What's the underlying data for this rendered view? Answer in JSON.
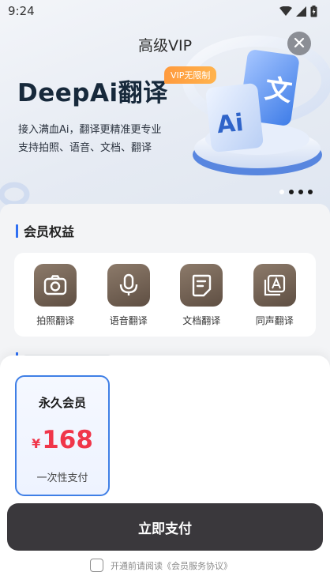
{
  "status_bar": {
    "time": "9:24"
  },
  "header": {
    "title": "高级VIP"
  },
  "hero": {
    "brand": "DeepAi翻译",
    "badge": "VIP无限制",
    "tagline_1": "接入满血Ai，翻译更精准更专业",
    "tagline_2": "支持拍照、语音、文档、翻译",
    "art_label": "Ai",
    "art_glyph": "文"
  },
  "benefits": {
    "title": "会员权益",
    "features": [
      {
        "label": "拍照翻译",
        "icon": "camera-icon"
      },
      {
        "label": "语音翻译",
        "icon": "microphone-icon"
      },
      {
        "label": "文档翻译",
        "icon": "document-icon"
      },
      {
        "label": "同声翻译",
        "icon": "simultaneous-translate-icon"
      }
    ]
  },
  "plan": {
    "name": "永久会员",
    "currency": "¥",
    "price": "168",
    "note": "一次性支付"
  },
  "pay_button": {
    "label": "立即支付"
  },
  "agreement": {
    "text": "开通前请阅读《会员服务协议》",
    "checked": false
  },
  "colors": {
    "accent_blue": "#2f6ff2",
    "price_red": "#f0364a",
    "pay_button": "#3a383c",
    "badge_orange": "#ff9a3d",
    "feature_icon_brown": "#6f5e50"
  }
}
